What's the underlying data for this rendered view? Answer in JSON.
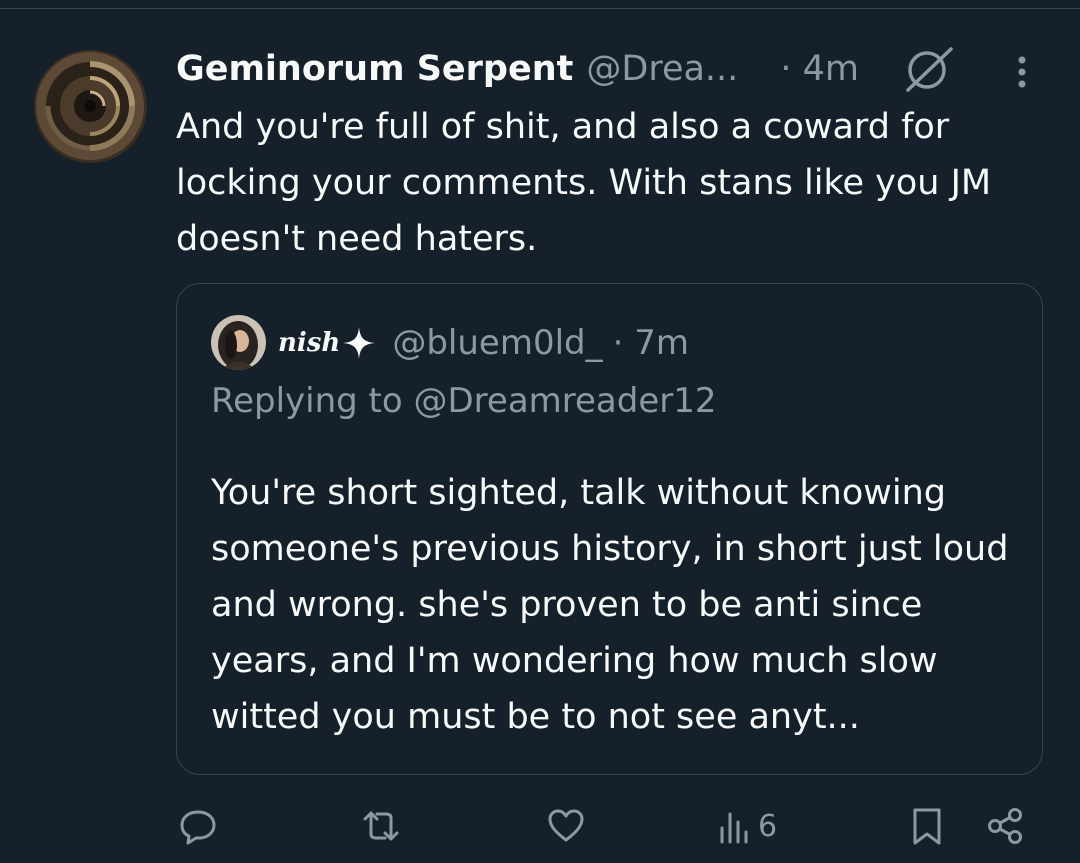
{
  "tweet": {
    "display_name": "Geminorum Serpent",
    "handle": "@Drea...",
    "time": "· 4m",
    "text": "And you're full of shit, and also a coward for locking your comments. With stans like you JM doesn't need haters."
  },
  "quoted_tweet": {
    "display_name": "nish",
    "handle": "@bluem0ld_",
    "time": "· 7m",
    "replying_to": "Replying to @Dreamreader12",
    "text": "You're short sighted, talk without knowing someone's previous history, in short just loud and wrong. she's proven to be anti since years, and I'm wondering how much slow witted you must be to not see anyt..."
  },
  "actions": {
    "views_count": "6"
  },
  "icons": [
    "grok-icon",
    "more-icon",
    "reply-icon",
    "retweet-icon",
    "like-icon",
    "views-icon",
    "bookmark-icon",
    "share-icon",
    "sparkle-icon"
  ],
  "colors": {
    "background": "#15202b",
    "text": "#f7f9f9",
    "muted": "#8b98a5",
    "border": "#38444d"
  }
}
